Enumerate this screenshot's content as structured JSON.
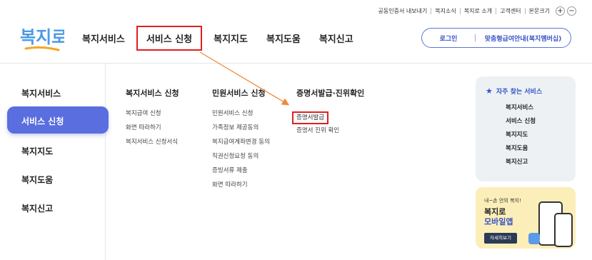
{
  "utility": [
    "공동인증서 내보내기",
    "복지소식",
    "복지로 소개",
    "고객센터",
    "본문크기"
  ],
  "utility_zoom": {
    "plus": "+",
    "minus": "−"
  },
  "logo": "복지로",
  "gnb": [
    {
      "label": "복지서비스",
      "active": false
    },
    {
      "label": "서비스 신청",
      "active": true
    },
    {
      "label": "복지지도",
      "active": false
    },
    {
      "label": "복지도움",
      "active": false
    },
    {
      "label": "복지신고",
      "active": false
    }
  ],
  "login": {
    "login_label": "로그인",
    "member_label": "맞춤형급여안내(복지멤버십)"
  },
  "sidebar": [
    {
      "label": "복지서비스",
      "active": false
    },
    {
      "label": "서비스 신청",
      "active": true
    },
    {
      "label": "복지지도",
      "active": false
    },
    {
      "label": "복지도움",
      "active": false
    },
    {
      "label": "복지신고",
      "active": false
    }
  ],
  "columns": [
    {
      "header": "복지서비스 신청",
      "items": [
        "복지급여 신청",
        "화면 따라하기",
        "복지서비스 신청서식"
      ],
      "highlight": null
    },
    {
      "header": "민원서비스 신청",
      "items": [
        "민원서비스 신청",
        "가족정보 제공동의",
        "복지급여계좌변경 동의",
        "직권신청요청 동의",
        "증빙서류 제출",
        "화면 따라하기"
      ],
      "highlight": null
    },
    {
      "header": "증명서발급·진위확인",
      "items": [
        "증명서발급",
        "증명서 진위 확인"
      ],
      "highlight": 0
    }
  ],
  "favorites": {
    "title": "자주 찾는 서비스",
    "items": [
      "복지서비스",
      "서비스 신청",
      "복지지도",
      "복지도움",
      "복지신고"
    ]
  },
  "banner": {
    "sub": "내~손 안의 복지!",
    "title1": "복지로",
    "title2": "모바일앱",
    "button": "자세히보기"
  },
  "colors": {
    "accent": "#5a6ee0",
    "highlight_box": "#e02020",
    "arrow": "#f08a3c"
  }
}
